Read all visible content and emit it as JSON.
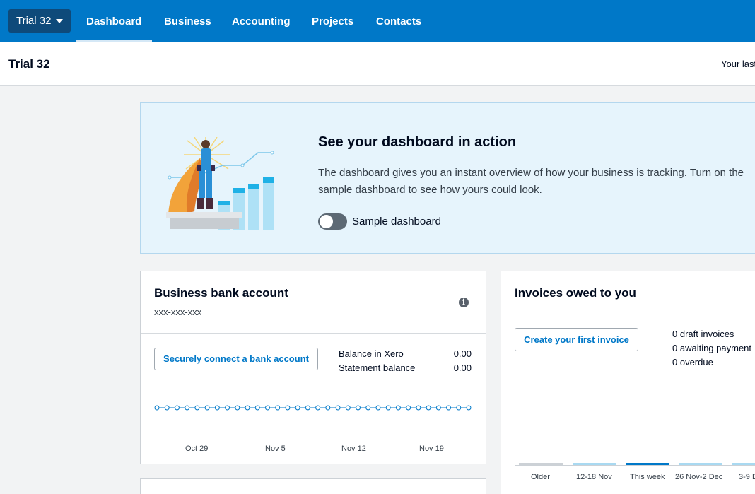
{
  "nav": {
    "org_name": "Trial 32",
    "items": [
      "Dashboard",
      "Business",
      "Accounting",
      "Projects",
      "Contacts"
    ]
  },
  "header": {
    "title": "Trial 32",
    "last_login_text": "Your last"
  },
  "promo": {
    "title": "See your dashboard in action",
    "description": "The dashboard gives you an instant overview of how your business is tracking. Turn on the sample dashboard to see how yours could look.",
    "toggle_label": "Sample dashboard",
    "toggle_on": false
  },
  "bank": {
    "title": "Business bank account",
    "account_number": "xxx-xxx-xxx",
    "connect_label": "Securely connect a bank account",
    "balance_in_xero_label": "Balance in Xero",
    "balance_in_xero_value": "0.00",
    "statement_balance_label": "Statement balance",
    "statement_balance_value": "0.00",
    "x_ticks": [
      "Oct 29",
      "Nov 5",
      "Nov 12",
      "Nov 19"
    ]
  },
  "invoices": {
    "title": "Invoices owed to you",
    "create_label": "Create your first invoice",
    "stats": [
      "0 draft invoices",
      "0 awaiting payment",
      "0 overdue"
    ],
    "bar_labels": [
      "Older",
      "12-18 Nov",
      "This week",
      "26 Nov-2 Dec",
      "3-9 D"
    ]
  },
  "colors": {
    "nav_bg": "#0078c8",
    "accent_blue": "#0078c8",
    "promo_bg": "#e6f4fc"
  }
}
